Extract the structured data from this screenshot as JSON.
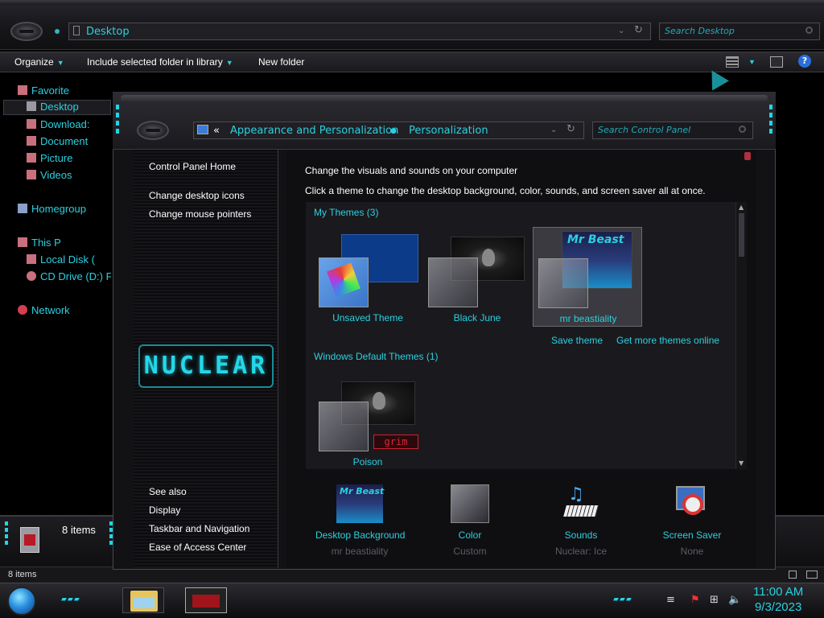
{
  "explorer": {
    "address": "Desktop",
    "search_placeholder": "Search Desktop",
    "commands": {
      "organize": "Organize",
      "include": "Include selected folder in library",
      "new_folder": "New folder"
    },
    "nav": [
      {
        "label": "Favorite",
        "icon": "star-icon",
        "color": "#c9707e"
      },
      {
        "label": "Desktop",
        "icon": "desktop-icon",
        "color": "#9a9aa2"
      },
      {
        "label": "Download:",
        "icon": "downloads-icon",
        "color": "#c9707e"
      },
      {
        "label": "Document",
        "icon": "documents-icon",
        "color": "#c9707e"
      },
      {
        "label": "Picture",
        "icon": "pictures-icon",
        "color": "#c9707e"
      },
      {
        "label": "Videos",
        "icon": "videos-icon",
        "color": "#c9707e"
      },
      {
        "label": "Homegroup",
        "icon": "homegroup-icon",
        "color": "#8aa0c8"
      },
      {
        "label": "This P",
        "icon": "computer-icon",
        "color": "#c9707e"
      },
      {
        "label": "Local Disk (",
        "icon": "disk-icon",
        "color": "#c9707e"
      },
      {
        "label": "CD Drive (D:) F",
        "icon": "cd-drive-icon",
        "color": "#c9707e"
      },
      {
        "label": "Network",
        "icon": "network-icon",
        "color": "#d04050"
      }
    ],
    "items_count_big": "8 items",
    "status_text": "8 items"
  },
  "control_panel": {
    "breadcrumb_prefix": "«",
    "breadcrumb": [
      "Appearance and Personalization",
      "Personalization"
    ],
    "search_placeholder": "Search Control Panel",
    "left_links": {
      "home": "Control Panel Home",
      "desktop_icons": "Change desktop icons",
      "mouse_pointers": "Change mouse pointers"
    },
    "logo_text": "NUCLEAR",
    "see_also": {
      "heading": "See also",
      "items": [
        "Display",
        "Taskbar and Navigation",
        "Ease of Access Center"
      ]
    },
    "heading": "Change the visuals and sounds on your computer",
    "subheading": "Click a theme to change the desktop background, color, sounds, and screen saver all at once.",
    "my_themes_header": "My Themes (3)",
    "default_themes_header": "Windows Default Themes (1)",
    "themes": [
      {
        "name": "Unsaved Theme"
      },
      {
        "name": "Black June"
      },
      {
        "name": "mr beastiality",
        "thumb_text": "Mr Beast"
      },
      {
        "name": "Poison",
        "thumb_text": "grim"
      }
    ],
    "save_theme": "Save theme",
    "get_more": "Get more themes online",
    "bottom": [
      {
        "label": "Desktop Background",
        "value": "mr beastiality",
        "icon": "desktop-background-icon"
      },
      {
        "label": "Color",
        "value": "Custom",
        "icon": "color-icon"
      },
      {
        "label": "Sounds",
        "value": "Nuclear: Ice",
        "icon": "sounds-icon"
      },
      {
        "label": "Screen Saver",
        "value": "None",
        "icon": "screen-saver-icon"
      }
    ]
  },
  "taskbar": {
    "time": "11:00 AM",
    "date": "9/3/2023"
  },
  "colors": {
    "accent": "#2bd0e0",
    "window_bg": "#121215",
    "status_muted": "#5c5c64"
  }
}
